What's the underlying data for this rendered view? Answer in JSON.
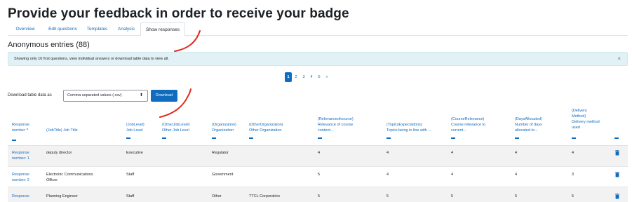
{
  "page": {
    "title": "Provide your feedback in order to receive your badge"
  },
  "tabs": [
    {
      "label": "Overview",
      "active": false
    },
    {
      "label": "Edit questions",
      "active": false
    },
    {
      "label": "Templates",
      "active": false
    },
    {
      "label": "Analysis",
      "active": false
    },
    {
      "label": "Show responses",
      "active": true
    }
  ],
  "section": {
    "title": "Anonymous entries (88)"
  },
  "alert": {
    "text": "Showing only 10 first questions, view individual answers or download table data to view all.",
    "close_symbol": "×"
  },
  "pagination": {
    "pages": [
      "1",
      "2",
      "3",
      "4",
      "5",
      "»"
    ],
    "current": "1"
  },
  "download": {
    "label": "Download table data as",
    "selected_format": "Comma separated values (.csv)",
    "select_arrow": "⬍",
    "button_label": "Download"
  },
  "table": {
    "columns": [
      {
        "lines": [
          "Response",
          "number"
        ],
        "sort": "^"
      },
      {
        "lines": [
          "(JobTitle) Job Title"
        ]
      },
      {
        "lines": [
          "(JobLevel)",
          "Job Level"
        ]
      },
      {
        "lines": [
          "(OtherJobLevel)",
          "Other Job Level"
        ]
      },
      {
        "lines": [
          "(Organization)",
          "Organization"
        ]
      },
      {
        "lines": [
          "(OtherOrganization)",
          "Other Organization"
        ]
      },
      {
        "lines": [
          "(Relevanceofcourse)",
          "Relevance of course",
          "content..."
        ]
      },
      {
        "lines": [
          "(TopicsExpectations)",
          "Topics being in line with ..."
        ]
      },
      {
        "lines": [
          "(CourseRelevance)",
          "Course relevance to",
          "current..."
        ]
      },
      {
        "lines": [
          "(DaysAllocated)",
          "Number of days",
          "allocated to..."
        ]
      },
      {
        "lines": [
          "(Delivery",
          "Method)",
          "Delivery method",
          "used"
        ]
      }
    ],
    "rows": [
      {
        "response": [
          "Response",
          "number: 1"
        ],
        "job_title": [
          "deputy director"
        ],
        "job_level": "Executive",
        "other_job_level": "",
        "organization": "Regulator",
        "other_organization": "",
        "relevance": "4",
        "topics": "4",
        "course_relevance": "4",
        "days": "4",
        "delivery": "4"
      },
      {
        "response": [
          "Response",
          "number: 2"
        ],
        "job_title": [
          "Electronic Communications",
          "Officer"
        ],
        "job_level": "Staff",
        "other_job_level": "",
        "organization": "Government",
        "other_organization": "",
        "relevance": "5",
        "topics": "4",
        "course_relevance": "4",
        "days": "4",
        "delivery": "3"
      },
      {
        "response": [
          "Response"
        ],
        "job_title": [
          "Planning Engineer"
        ],
        "job_level": "Staff",
        "other_job_level": "",
        "organization": "Other",
        "other_organization": "TTCL Corporation",
        "relevance": "5",
        "topics": "5",
        "course_relevance": "5",
        "days": "5",
        "delivery": "5"
      }
    ]
  },
  "colors": {
    "link": "#0f6cbf",
    "primary_button": "#0f6cbf",
    "alert_background": "#e1f1f6",
    "striped_row": "#f2f2f2",
    "annotation_red": "#e0281e"
  },
  "icons": {
    "delete": "trash-icon",
    "sort": "sort-ascending-icon",
    "close": "close-icon"
  }
}
